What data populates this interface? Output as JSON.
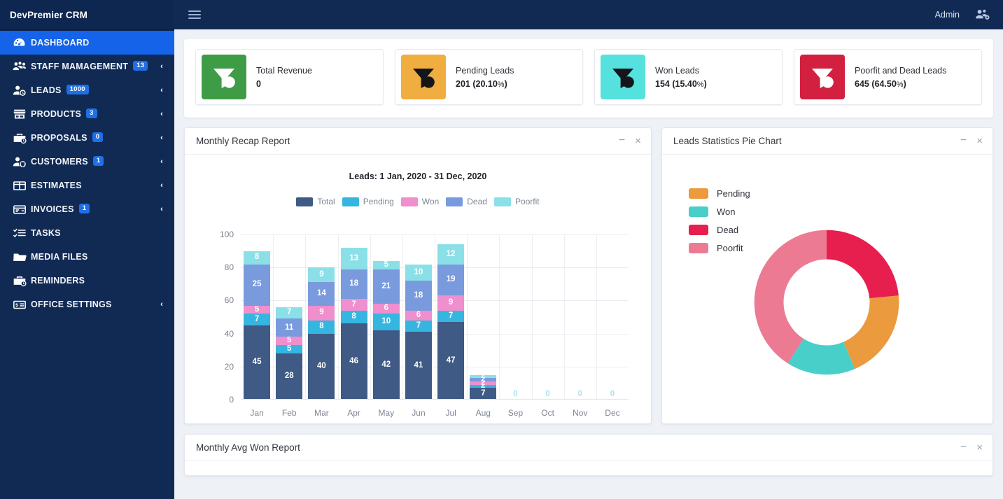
{
  "brand": {
    "title": "DevPremier CRM"
  },
  "topbar": {
    "menu_icon": "hamburger-icon",
    "admin_label": "Admin",
    "admin_icon": "users-cog-icon"
  },
  "sidebar": {
    "items": [
      {
        "label": "DASHBOARD",
        "icon": "dashboard-gauge-icon",
        "badge": null,
        "chevron": false,
        "active": true
      },
      {
        "label": "STAFF MAMAGEMENT",
        "icon": "users-group-icon",
        "badge": "13",
        "chevron": true,
        "active": false
      },
      {
        "label": "LEADS",
        "icon": "user-clock-icon",
        "badge": "1000",
        "chevron": true,
        "active": false
      },
      {
        "label": "PRODUCTS",
        "icon": "store-icon",
        "badge": "3",
        "chevron": true,
        "active": false
      },
      {
        "label": "PROPOSALS",
        "icon": "briefcase-clock-icon",
        "badge": "0",
        "chevron": true,
        "active": false
      },
      {
        "label": "CUSTOMERS",
        "icon": "user-shield-icon",
        "badge": "1",
        "chevron": true,
        "active": false
      },
      {
        "label": "ESTIMATES",
        "icon": "columns-icon",
        "badge": null,
        "chevron": true,
        "active": false
      },
      {
        "label": "INVOICES",
        "icon": "invoice-card-icon",
        "badge": "1",
        "chevron": true,
        "active": false
      },
      {
        "label": "TASKS",
        "icon": "tasks-list-icon",
        "badge": null,
        "chevron": false,
        "active": false
      },
      {
        "label": "MEDIA FILES",
        "icon": "folder-icon",
        "badge": null,
        "chevron": false,
        "active": false
      },
      {
        "label": "REMINDERS",
        "icon": "briefcase-clock-icon",
        "badge": null,
        "chevron": false,
        "active": false
      },
      {
        "label": "OFFICE SETTINGS",
        "icon": "money-card-icon",
        "badge": null,
        "chevron": true,
        "active": false
      }
    ]
  },
  "stats": [
    {
      "title": "Total Revenue",
      "value": "0",
      "percent": null,
      "color": "#3f9c46",
      "icon": "funnel-dollar-icon"
    },
    {
      "title": "Pending Leads",
      "value": "201",
      "percent": "(20.10",
      "color": "#f0ad40",
      "icon": "funnel-dollar-icon"
    },
    {
      "title": "Won Leads",
      "value": "154",
      "percent": "(15.40",
      "color": "#55e1dd",
      "icon": "funnel-dollar-icon"
    },
    {
      "title": "Poorfit and Dead Leads",
      "value": "645",
      "percent": "(64.50",
      "color": "#d32040",
      "icon": "funnel-dollar-icon"
    }
  ],
  "panels": {
    "recap": {
      "title": "Monthly Recap Report",
      "minimize": "−",
      "close": "×"
    },
    "pie": {
      "title": "Leads Statistics Pie Chart",
      "minimize": "−",
      "close": "×"
    },
    "bottom": {
      "title": "Monthly Avg Won Report",
      "minimize": "−",
      "close": "×"
    }
  },
  "chart_data": [
    {
      "type": "bar",
      "id": "monthly-recap-report",
      "title": "Leads: 1 Jan, 2020 - 31 Dec, 2020",
      "stacked": true,
      "xlabel": "",
      "ylabel": "",
      "ylim": [
        0,
        100
      ],
      "yticks": [
        0,
        20,
        40,
        60,
        80,
        100
      ],
      "grid": true,
      "legend_position": "top-center",
      "categories": [
        "Jan",
        "Feb",
        "Mar",
        "Apr",
        "May",
        "Jun",
        "Jul",
        "Aug",
        "Sep",
        "Oct",
        "Nov",
        "Dec"
      ],
      "series": [
        {
          "name": "Total",
          "color": "#3e5a85",
          "values": [
            45,
            28,
            40,
            46,
            42,
            41,
            47,
            7,
            0,
            0,
            0,
            0
          ]
        },
        {
          "name": "Pending",
          "color": "#35b6e0",
          "values": [
            7,
            5,
            8,
            8,
            10,
            7,
            7,
            2,
            0,
            0,
            0,
            0
          ]
        },
        {
          "name": "Won",
          "color": "#ef8fcd",
          "values": [
            5,
            5,
            9,
            7,
            6,
            6,
            9,
            2,
            0,
            0,
            0,
            0
          ]
        },
        {
          "name": "Dead",
          "color": "#7a9ade",
          "values": [
            25,
            11,
            14,
            18,
            21,
            18,
            19,
            2,
            0,
            0,
            0,
            0
          ]
        },
        {
          "name": "Poorfit",
          "color": "#8be0e8",
          "values": [
            8,
            7,
            9,
            13,
            5,
            10,
            12,
            2,
            0,
            0,
            0,
            0
          ]
        }
      ],
      "zero_labels": {
        "value": "0",
        "color": "#a9e4ef",
        "months": [
          "Sep",
          "Oct",
          "Nov",
          "Dec"
        ]
      }
    },
    {
      "type": "pie",
      "id": "leads-statistics-pie-chart",
      "title": "Leads Statistics Pie Chart",
      "donut": true,
      "legend_position": "left",
      "labels": [
        "Pending",
        "Won",
        "Dead",
        "Poorfit"
      ],
      "colors": [
        "#eb9a3d",
        "#49cfc9",
        "#e71f4e",
        "#ed7a93"
      ],
      "values": [
        20.1,
        15.4,
        23.5,
        41.0
      ]
    }
  ]
}
